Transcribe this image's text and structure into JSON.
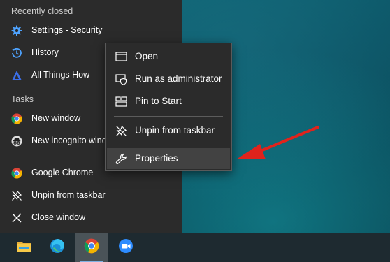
{
  "jumplist": {
    "recently_closed_header": "Recently closed",
    "recent_items": [
      {
        "label": "Settings - Security",
        "icon": "gear-icon"
      },
      {
        "label": "History",
        "icon": "history-icon"
      },
      {
        "label": "All Things How",
        "icon": "triangle-logo-icon"
      }
    ],
    "tasks_header": "Tasks",
    "task_items": [
      {
        "label": "New window",
        "icon": "chrome-icon"
      },
      {
        "label": "New incognito wind",
        "icon": "incognito-icon"
      }
    ],
    "app_items": [
      {
        "label": "Google Chrome",
        "icon": "chrome-icon"
      },
      {
        "label": "Unpin from taskbar",
        "icon": "unpin-icon"
      },
      {
        "label": "Close window",
        "icon": "close-icon"
      }
    ]
  },
  "context_menu": {
    "items": [
      {
        "label": "Open",
        "icon": "window-icon"
      },
      {
        "label": "Run as administrator",
        "icon": "shield-icon"
      },
      {
        "label": "Pin to Start",
        "icon": "pin-start-icon"
      },
      {
        "label": "Unpin from taskbar",
        "icon": "unpin-icon"
      },
      {
        "label": "Properties",
        "icon": "wrench-icon",
        "highlighted": true
      }
    ]
  },
  "taskbar": {
    "apps": [
      {
        "icon": "file-explorer-icon"
      },
      {
        "icon": "edge-icon"
      },
      {
        "icon": "chrome-icon",
        "active": true
      },
      {
        "icon": "zoom-icon"
      }
    ]
  },
  "colors": {
    "menu_bg": "#2b2b2b",
    "accent_blue": "#4ea3ff",
    "annotation_arrow": "#e0231c",
    "taskbar_bg": "#1e2a30"
  }
}
